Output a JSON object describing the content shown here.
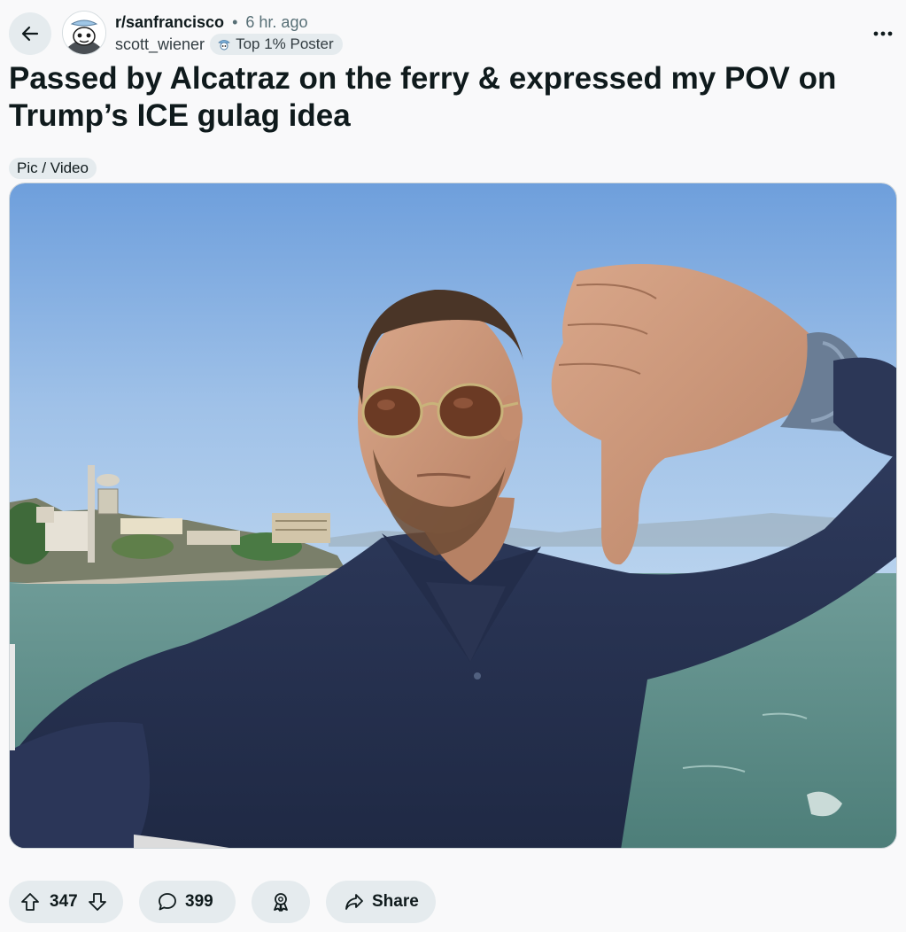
{
  "header": {
    "subreddit": "r/sanfrancisco",
    "separator": "•",
    "time": "6 hr. ago",
    "username": "scott_wiener",
    "flair": "Top 1% Poster",
    "back_icon": "arrow-left-icon",
    "more_icon": "more-horizontal-icon"
  },
  "post": {
    "title": "Passed by Alcatraz on the ferry & expressed my POV on Trump’s ICE gulag idea",
    "tag": "Pic / Video",
    "image_icon": "photo-image"
  },
  "actions": {
    "upvotes": "347",
    "comments": "399",
    "share_label": "Share",
    "upvote_icon": "arrow-up-icon",
    "downvote_icon": "arrow-down-icon",
    "comment_icon": "comment-bubble-icon",
    "award_icon": "award-ribbon-icon",
    "share_icon": "share-arrow-icon"
  },
  "colors": {
    "background": "#f9f9fa",
    "pill": "#e5ebee",
    "text": "#0f1a1c",
    "muted": "#576f76"
  }
}
